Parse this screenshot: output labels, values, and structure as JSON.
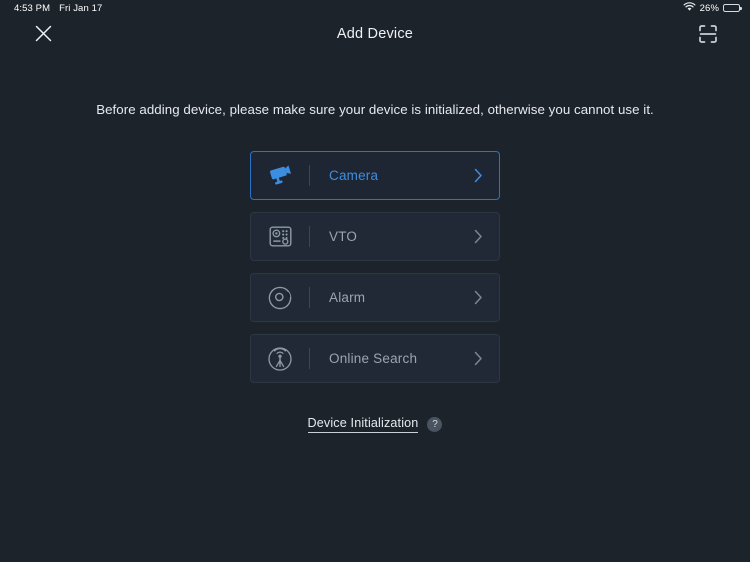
{
  "statusbar": {
    "time": "4:53 PM",
    "date": "Fri Jan 17",
    "wifi_icon": "wifi-icon",
    "battery_percent": "26%",
    "battery_level": 26,
    "battery_color": "#32d74b"
  },
  "header": {
    "title": "Add Device",
    "close_icon": "close-icon",
    "scan_icon": "scan-qr-icon"
  },
  "main": {
    "subtitle": "Before adding device, please make sure your device is initialized, otherwise you cannot use it.",
    "options": [
      {
        "label": "Camera",
        "icon": "cctv-camera-icon",
        "selected": true
      },
      {
        "label": "VTO",
        "icon": "door-station-icon",
        "selected": false
      },
      {
        "label": "Alarm",
        "icon": "alarm-detector-icon",
        "selected": false
      },
      {
        "label": "Online Search",
        "icon": "radar-signal-icon",
        "selected": false
      }
    ],
    "init_link": "Device Initialization",
    "help_badge": "?"
  },
  "colors": {
    "background": "#1d232b",
    "card_background": "#222936",
    "card_border": "#2d3643",
    "accent": "#3d8ee0",
    "accent_border": "#2e72c4",
    "muted_text": "#9aa4b2",
    "primary_text": "#e6eaef"
  }
}
